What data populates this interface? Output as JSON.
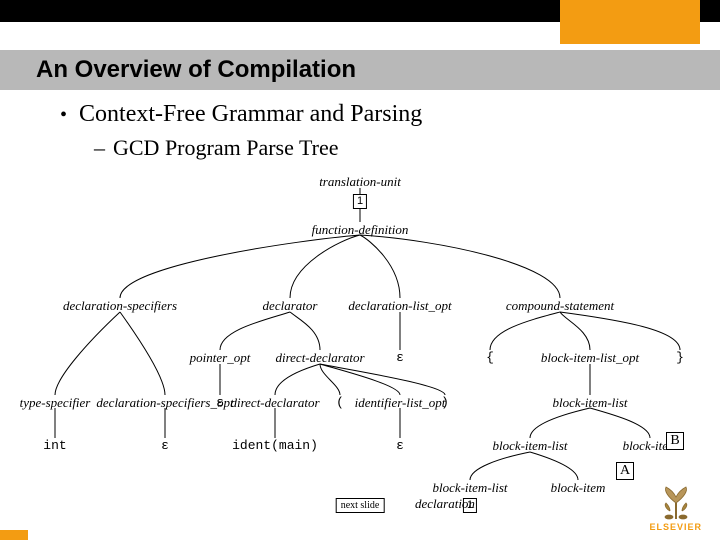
{
  "header": {
    "title": "An Overview of Compilation"
  },
  "bullets": {
    "main": "Context-Free Grammar and Parsing",
    "sub": "GCD Program Parse Tree"
  },
  "tree": {
    "n_translation_unit": "translation-unit",
    "tag1": "1",
    "n_function_definition": "function-definition",
    "n_declaration_specifiers": "declaration-specifiers",
    "n_declarator": "declarator",
    "n_declaration_list_opt": "declaration-list_opt",
    "n_compound_statement": "compound-statement",
    "n_pointer_opt": "pointer_opt",
    "n_direct_declarator": "direct-declarator",
    "eps1": "ε",
    "brace_l": "{",
    "n_block_item_list_opt": "block-item-list_opt",
    "brace_r": "}",
    "eps2": "ε",
    "n_direct_declarator2": "direct-declarator",
    "lparen": "(",
    "n_identifier_list_opt": "identifier-list_opt",
    "rparen": ")",
    "n_block_item_list": "block-item-list",
    "n_type_specifier": "type-specifier",
    "n_declaration_specifiers_opt": "declaration-specifiers_opt",
    "n_ident_main": "ident(main)",
    "eps3": "ε",
    "n_block_item_list2": "block-item-list",
    "n_block_item": "block-item",
    "n_int": "int",
    "eps4": "ε",
    "n_block_item_list3": "block-item-list",
    "n_block_item2": "block-item",
    "tag2": "1",
    "n_declaration": "declaration"
  },
  "controls": {
    "B": "B",
    "A": "A",
    "next": "next slide"
  },
  "brand": "ELSEVIER"
}
